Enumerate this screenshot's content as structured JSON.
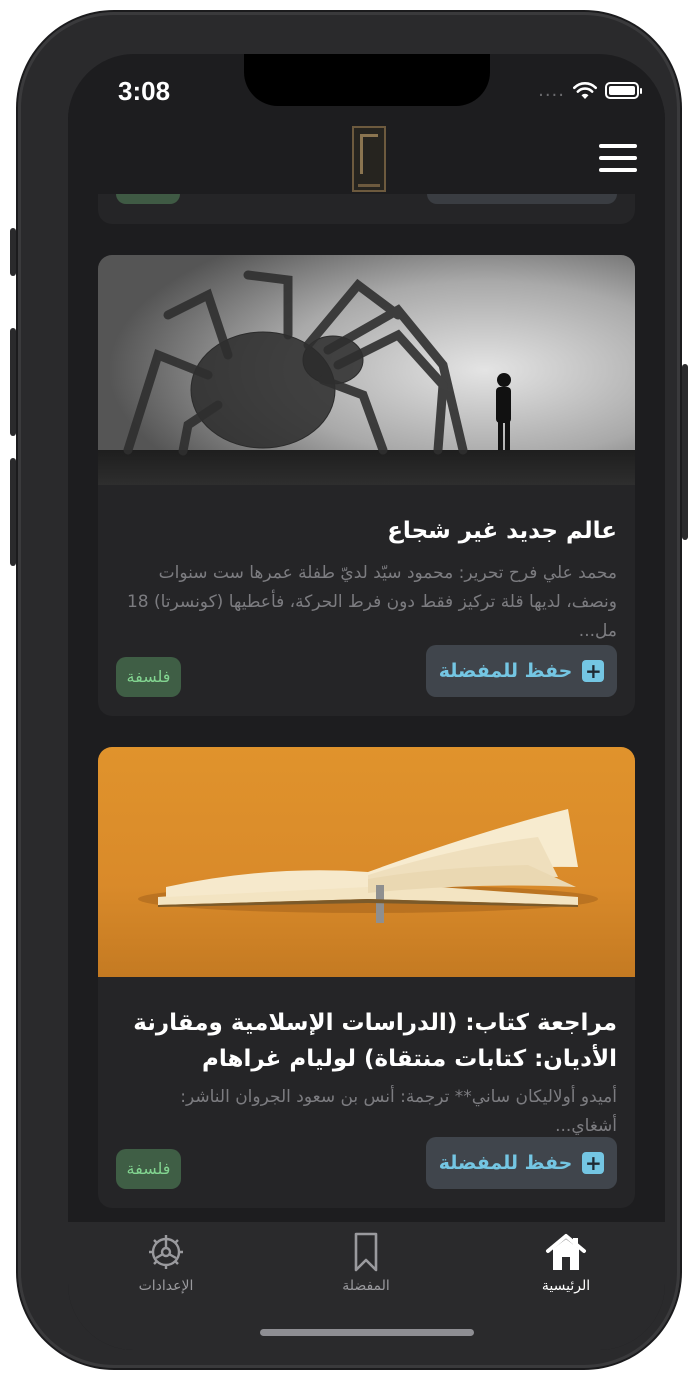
{
  "status_bar": {
    "time": "3:08",
    "signal_dots": "...."
  },
  "header": {
    "logo_icon": "app-logo",
    "menu_icon": "hamburger-menu-icon"
  },
  "articles": [
    {
      "title": "عالم جديد غير شجاع",
      "excerpt": "محمد علي فرح تحرير: محمود سيّد لديّ طفلة عمرها ست سنوات ونصف، لديها قلة تركيز فقط دون فرط الحركة، فأعطيها (كونسرتا) 18 مل...",
      "favorite_label": "حفظ للمفضلة",
      "category": "فلسفة",
      "image": "spider-silhouette-illustration"
    },
    {
      "title": "مراجعة كتاب: (الدراسات الإسلامية ومقارنة الأديان: كتابات منتقاة) لوليام غراهام",
      "excerpt": "أميدو أولاليكان ساني** ترجمة: أنس بن سعود الجروان الناشر: أشغاي...",
      "favorite_label": "حفظ للمفضلة",
      "category": "فلسفة",
      "image": "open-book-photo"
    }
  ],
  "tabs": [
    {
      "label": "الإعدادات",
      "icon": "gear-icon",
      "active": false
    },
    {
      "label": "المفضلة",
      "icon": "bookmark-icon",
      "active": false
    },
    {
      "label": "الرئيسية",
      "icon": "home-icon",
      "active": true
    }
  ],
  "colors": {
    "accent": "#74c6e3",
    "tag_text": "#82d490",
    "tag_bg": "#3f5e45",
    "background": "#1d1d1f"
  }
}
